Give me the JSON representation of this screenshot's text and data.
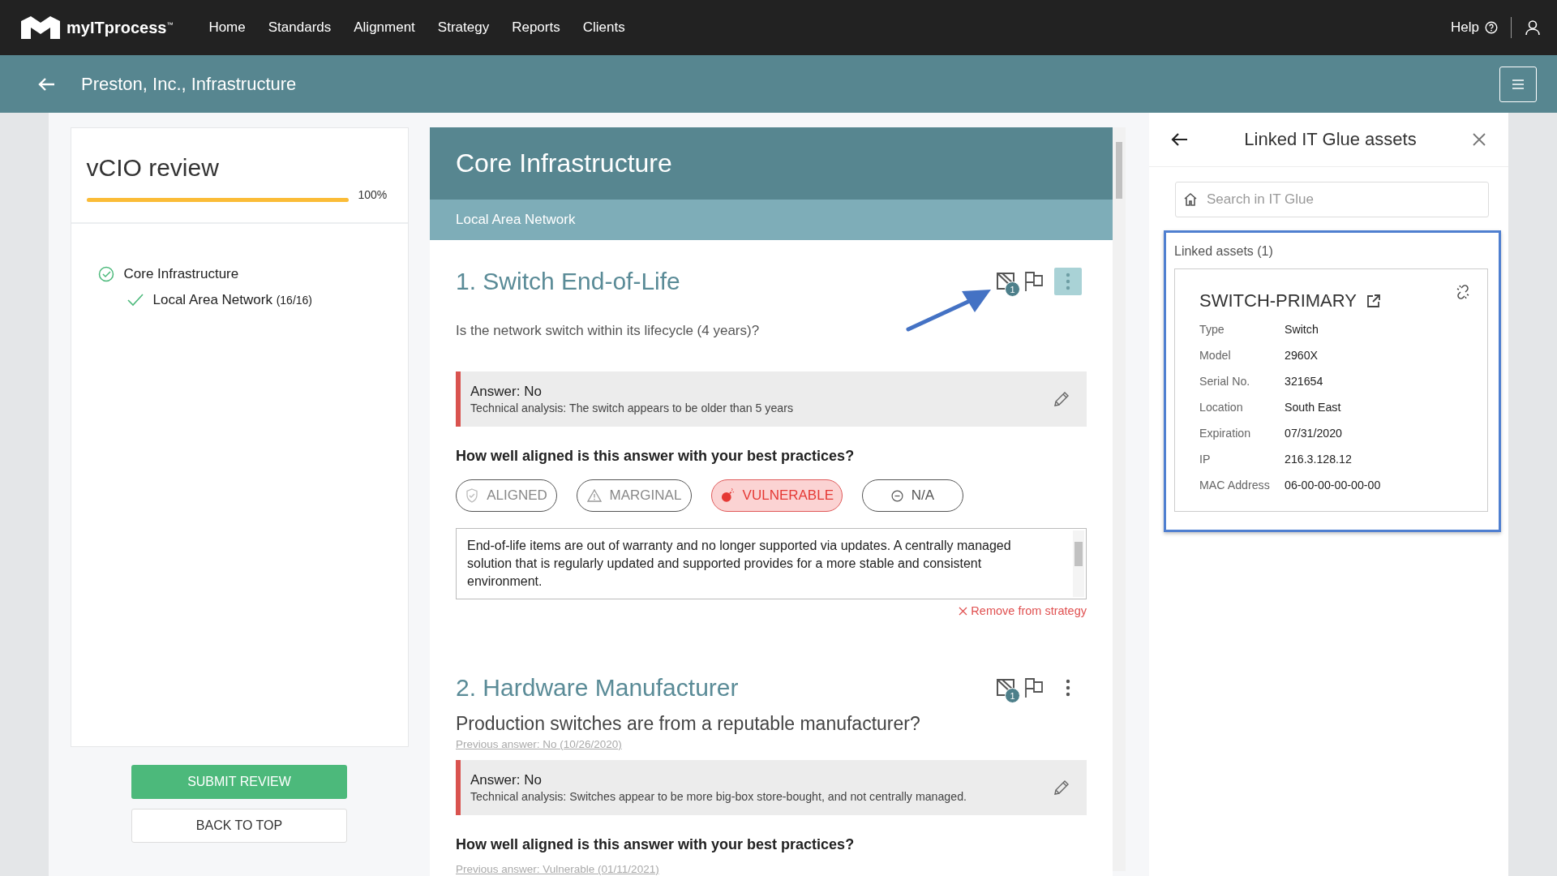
{
  "nav": {
    "logo": "myITprocess$^{™}$",
    "links": [
      {
        "label": "Home"
      },
      {
        "label": "Standards"
      },
      {
        "label": "Alignment"
      },
      {
        "label": "Strategy"
      },
      {
        "label": "Reports"
      },
      {
        "label": "Clients"
      }
    ],
    "help": "Help"
  },
  "header": {
    "title": "Preston, Inc., Infrastructure"
  },
  "review": {
    "title": "vCIO review",
    "progress": {
      "level": 1.0,
      "reading": "100%"
    },
    "tree": [
      {
        "label": "Core Infrastructure",
        "checked": true,
        "children": [
          {
            "label": "Local Area Network",
            "count": "(16/16)",
            "checked": true
          }
        ]
      }
    ],
    "buttons": [
      {
        "label": "SUBMIT REVIEW",
        "kind": "primary"
      },
      {
        "label": "BACK TO TOP",
        "kind": "secondary"
      }
    ]
  },
  "section": {
    "title": "Core Infrastructure",
    "subtitle": "Local Area Network",
    "questions": [
      {
        "title": "1. Switch End-of-Life",
        "asset_count": "1",
        "menu_active": true,
        "large": false,
        "question": "Is the network switch within its lifecycle (4 years)?",
        "answer": "Answer: No",
        "analysis": "Technical analysis: The switch appears to be older than 5 years",
        "prompt": "How well aligned is this answer with your best practices?",
        "options": [
          {
            "label": "ALIGNED",
            "kind": "aligned",
            "selected": false
          },
          {
            "label": "MARGINAL",
            "kind": "marginal",
            "selected": false
          },
          {
            "label": "VULNERABLE",
            "kind": "vulnerable",
            "selected": true
          },
          {
            "label": "N/A",
            "kind": "na",
            "selected": false
          }
        ],
        "notes": "End-of-life items are out of warranty and no longer supported via updates. A centrally managed solution that is regularly updated and supported provides for a more stable and consistent environment.",
        "remove": "Remove from strategy"
      },
      {
        "title": "2. Hardware Manufacturer",
        "asset_count": "1",
        "menu_active": false,
        "large": true,
        "question": "Production switches are from a reputable manufacturer?",
        "previous_answer": "Previous answer: No (10/26/2020)",
        "answer": "Answer: No",
        "analysis": "Technical analysis: Switches appear to be more big-box store-bought, and not centrally managed.",
        "prompt": "How well aligned is this answer with your best practices?",
        "previous_alignment": "Previous answer: Vulnerable (01/11/2021)"
      }
    ]
  },
  "assets_panel": {
    "title": "Linked IT Glue assets",
    "search_placeholder": "Search in IT Glue",
    "linked_heading": "Linked assets (1)",
    "assets": [
      {
        "name": "SWITCH-PRIMARY",
        "fields": [
          {
            "label": "Type",
            "value": "Switch"
          },
          {
            "label": "Model",
            "value": "2960X"
          },
          {
            "label": "Serial No.",
            "value": "321654"
          },
          {
            "label": "Location",
            "value": "South East"
          },
          {
            "label": "Expiration",
            "value": "07/31/2020"
          },
          {
            "label": "IP",
            "value": "216.3.128.12"
          },
          {
            "label": "MAC Address",
            "value": "06-00-00-00-00-00"
          }
        ]
      }
    ]
  }
}
